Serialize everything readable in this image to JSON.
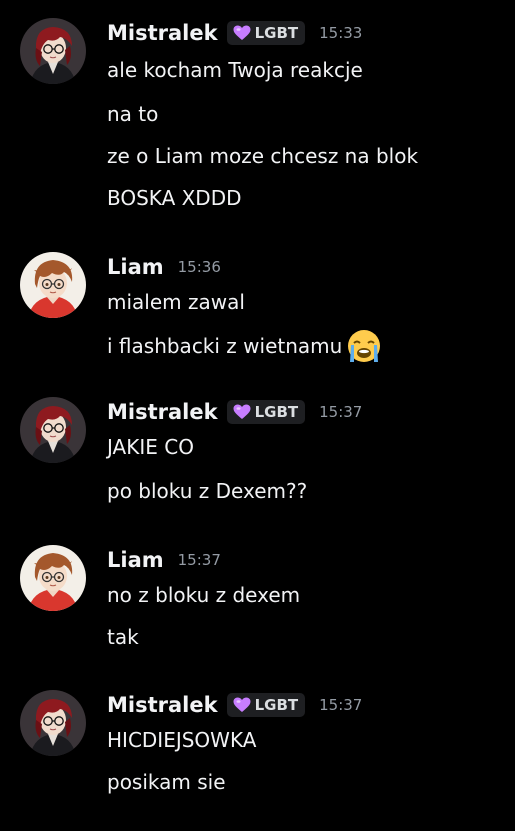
{
  "colors": {
    "background": "#000000",
    "text": "#f2f3f5",
    "muted": "#949ba4",
    "tag_bg": "#1e1f22",
    "heart": "#c77dff"
  },
  "messages": [
    {
      "author": "Mistralek",
      "role_tag": "LGBT",
      "role_icon": "purple-heart-icon",
      "time": "15:33",
      "avatar": "mistralek-avatar",
      "lines": [
        {
          "text": "ale kocham Twoja reakcje"
        },
        {
          "text": "na to"
        },
        {
          "text": "ze o Liam moze chcesz na blok"
        },
        {
          "text": "BOSKA XDDD"
        }
      ]
    },
    {
      "author": "Liam",
      "time": "15:36",
      "avatar": "liam-avatar",
      "lines": [
        {
          "text": "mialem zawal"
        },
        {
          "text": "i flashbacki z wietnamu",
          "emoji": "loudly-crying-face-icon"
        }
      ]
    },
    {
      "author": "Mistralek",
      "role_tag": "LGBT",
      "role_icon": "purple-heart-icon",
      "time": "15:37",
      "avatar": "mistralek-avatar",
      "lines": [
        {
          "text": "JAKIE CO"
        },
        {
          "text": "po bloku z Dexem??"
        }
      ]
    },
    {
      "author": "Liam",
      "time": "15:37",
      "avatar": "liam-avatar",
      "lines": [
        {
          "text": "no z bloku z dexem"
        },
        {
          "text": "tak"
        }
      ]
    },
    {
      "author": "Mistralek",
      "role_tag": "LGBT",
      "role_icon": "purple-heart-icon",
      "time": "15:37",
      "avatar": "mistralek-avatar",
      "lines": [
        {
          "text": "HICDIEJSOWKA"
        },
        {
          "text": "posikam sie"
        }
      ]
    }
  ]
}
